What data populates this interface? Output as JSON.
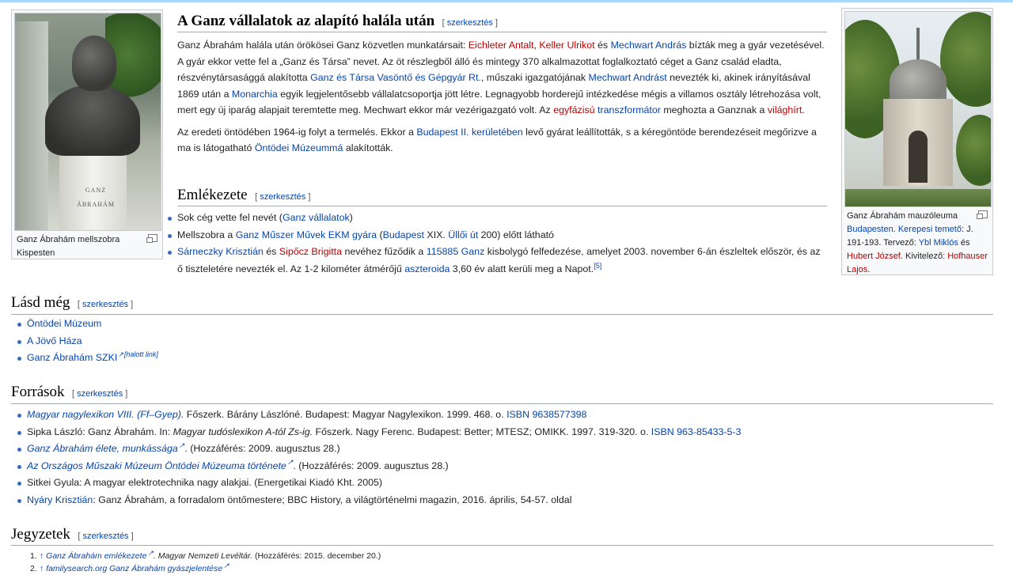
{
  "left_figure": {
    "image_text": "GANZ ÁBRAHÁM",
    "caption": "Ganz Ábrahám mellszobra Kispesten"
  },
  "right_figure": {
    "caption_parts": [
      {
        "t": "Ganz Ábrahám mauzóleuma ",
        "k": "plain"
      },
      {
        "t": "Budapesten",
        "k": "link"
      },
      {
        "t": ". ",
        "k": "plain"
      },
      {
        "t": "Kerepesi temető",
        "k": "link"
      },
      {
        "t": ": J. 191-193. Tervező: ",
        "k": "plain"
      },
      {
        "t": "Ybl Miklós",
        "k": "link"
      },
      {
        "t": " és ",
        "k": "plain"
      },
      {
        "t": "Hubert József",
        "k": "red"
      },
      {
        "t": ". Kivitelező: ",
        "k": "plain"
      },
      {
        "t": "Hofhauser Lajos",
        "k": "red"
      },
      {
        "t": ".",
        "k": "plain"
      }
    ]
  },
  "section_ganz": {
    "title": "A Ganz vállalatok az alapító halála után",
    "edit": "szerkesztés",
    "p1": [
      {
        "t": "Ganz Ábrahám halála után örökösei Ganz közvetlen munkatársait: ",
        "k": "plain"
      },
      {
        "t": "Eichleter Antalt",
        "k": "red"
      },
      {
        "t": ", ",
        "k": "plain"
      },
      {
        "t": "Keller Ulrikot",
        "k": "red"
      },
      {
        "t": " és ",
        "k": "plain"
      },
      {
        "t": "Mechwart András",
        "k": "link"
      },
      {
        "t": " bízták meg a gyár vezetésével. A gyár ekkor vette fel a „Ganz és Társa” nevet. Az öt részlegből álló és mintegy 370 alkalmazottat foglalkoztató céget a Ganz család eladta, részvénytársasággá alakította ",
        "k": "plain"
      },
      {
        "t": "Ganz és Társa Vasöntő és Gépgyár Rt.",
        "k": "link"
      },
      {
        "t": ", műszaki igazgatójának ",
        "k": "plain"
      },
      {
        "t": "Mechwart Andrást",
        "k": "link"
      },
      {
        "t": " nevezték ki, akinek irányításával 1869 után a ",
        "k": "plain"
      },
      {
        "t": "Monarchia",
        "k": "link"
      },
      {
        "t": " egyik legjelentősebb vállalatcsoportja jött létre. Legnagyobb horderejű intézkedése mégis a villamos osztály létrehozása volt, mert egy új iparág alapjait teremtette meg. Mechwart ekkor már vezérigazgató volt. Az ",
        "k": "plain"
      },
      {
        "t": "egyfázisú",
        "k": "red"
      },
      {
        "t": " ",
        "k": "plain"
      },
      {
        "t": "transzformátor",
        "k": "link"
      },
      {
        "t": " meghozta a Ganznak a ",
        "k": "plain"
      },
      {
        "t": "világhírt",
        "k": "red"
      },
      {
        "t": ".",
        "k": "plain"
      }
    ],
    "p2": [
      {
        "t": "Az eredeti öntödében 1964-ig folyt a termelés. Ekkor a ",
        "k": "plain"
      },
      {
        "t": "Budapest II. kerületében",
        "k": "link"
      },
      {
        "t": " levő gyárat leállították, s a kéregöntöde berendezéseit megőrizve a ma is látogatható ",
        "k": "plain"
      },
      {
        "t": "Öntödei Múzeummá",
        "k": "link"
      },
      {
        "t": " alakították.",
        "k": "plain"
      }
    ]
  },
  "section_emlek": {
    "title": "Emlékezete",
    "edit": "szerkesztés",
    "items": [
      [
        {
          "t": "Sok cég vette fel nevét (",
          "k": "plain"
        },
        {
          "t": "Ganz vállalatok",
          "k": "link"
        },
        {
          "t": ")",
          "k": "plain"
        }
      ],
      [
        {
          "t": "Mellszobra a ",
          "k": "plain"
        },
        {
          "t": "Ganz Műszer Művek EKM gyára",
          "k": "link"
        },
        {
          "t": " (",
          "k": "plain"
        },
        {
          "t": "Budapest",
          "k": "link"
        },
        {
          "t": " XIX. ",
          "k": "plain"
        },
        {
          "t": "Üllői út",
          "k": "link"
        },
        {
          "t": " 200) előtt látható",
          "k": "plain"
        }
      ],
      [
        {
          "t": "Sárneczky Krisztián",
          "k": "link"
        },
        {
          "t": " és ",
          "k": "plain"
        },
        {
          "t": "Sipőcz Brigitta",
          "k": "red"
        },
        {
          "t": " nevéhez fűződik a ",
          "k": "plain"
        },
        {
          "t": "115885 Ganz",
          "k": "link"
        },
        {
          "t": " kisbolygó felfedezése, amelyet 2003. november 6-án észleltek először, és az ő tiszteletére nevezték el. Az 1-2 kilométer átmérőjű ",
          "k": "plain"
        },
        {
          "t": "aszteroida",
          "k": "link"
        },
        {
          "t": " 3,60 év alatt kerüli meg a Napot.",
          "k": "plain"
        },
        {
          "t": "[5]",
          "k": "sup"
        }
      ]
    ]
  },
  "section_lasd": {
    "title": "Lásd még",
    "edit": "szerkesztés",
    "items": [
      [
        {
          "t": "Öntödei Múzeum",
          "k": "link"
        }
      ],
      [
        {
          "t": "A Jövő Háza",
          "k": "link"
        }
      ],
      [
        {
          "t": "Ganz Ábrahám SZKI",
          "k": "ext"
        },
        {
          "t": "[halott link]",
          "k": "supi"
        }
      ]
    ]
  },
  "section_forras": {
    "title": "Források",
    "edit": "szerkesztés",
    "items": [
      [
        {
          "t": "Magyar nagylexikon VIII. (Ff–Gyep).",
          "k": "ilink"
        },
        {
          "t": " Főszerk. Bárány Lászlóné. Budapest: Magyar Nagylexikon. 1999. 468. o. ",
          "k": "plain"
        },
        {
          "t": "ISBN 9638577398",
          "k": "link"
        }
      ],
      [
        {
          "t": "Sipka László: Ganz Ábrahám. In: ",
          "k": "plain"
        },
        {
          "t": "Magyar tudóslexikon A-tól Zs-ig.",
          "k": "italic"
        },
        {
          "t": " Főszerk. Nagy Ferenc. Budapest: Better; MTESZ; OMIKK. 1997. 319-320. o. ",
          "k": "plain"
        },
        {
          "t": "ISBN 963-85433-5-3",
          "k": "link"
        }
      ],
      [
        {
          "t": "Ganz Ábrahám élete, munkássága",
          "k": "iext"
        },
        {
          "t": ". (Hozzáférés: 2009. augusztus 28.)",
          "k": "plain"
        }
      ],
      [
        {
          "t": "Az Országos Műszaki Múzeum Öntödei Múzeuma története",
          "k": "iext"
        },
        {
          "t": ". (Hozzáférés: 2009. augusztus 28.)",
          "k": "plain"
        }
      ],
      [
        {
          "t": "Sitkei Gyula: A magyar elektrotechnika nagy alakjai. (Energetikai Kiadó Kht. 2005)",
          "k": "plain"
        }
      ],
      [
        {
          "t": "Nyáry Krisztián",
          "k": "link"
        },
        {
          "t": ": Ganz Ábrahám, a forradalom öntőmestere; BBC History, a világtörténelmi magazin, 2016. április, 54-57. oldal",
          "k": "plain"
        }
      ]
    ]
  },
  "section_jegyzet": {
    "title": "Jegyzetek",
    "edit": "szerkesztés",
    "items": [
      {
        "num": "1.",
        "parts": [
          {
            "t": "↑ ",
            "k": "link"
          },
          {
            "t": "Ganz Ábrahám emlékezete",
            "k": "iext"
          },
          {
            "t": ". Magyar Nemzeti Levéltár.",
            "k": "italic"
          },
          {
            "t": " (Hozzáférés: 2015. december 20.)",
            "k": "plain"
          }
        ]
      },
      {
        "num": "2.",
        "parts": [
          {
            "t": "↑ ",
            "k": "link"
          },
          {
            "t": "familysearch.org Ganz Ábrahám gyászjelentése",
            "k": "iext"
          }
        ]
      }
    ]
  }
}
